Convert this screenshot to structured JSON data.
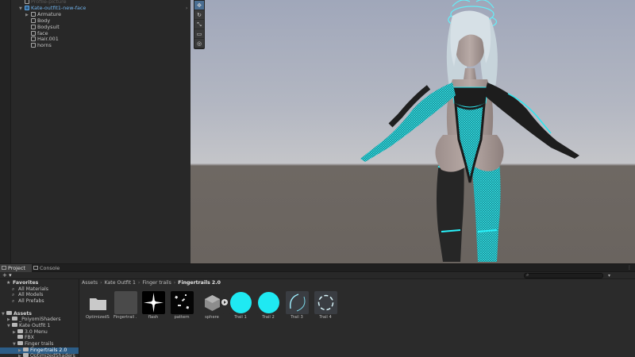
{
  "hierarchy": {
    "items": [
      {
        "label": "Profile-picture",
        "depth": 0,
        "faded": true
      },
      {
        "label": "Kate-outfit1-new-face",
        "depth": 0,
        "root": true,
        "expanded": true
      },
      {
        "label": "Armature",
        "depth": 1,
        "collapsed": true
      },
      {
        "label": "Body",
        "depth": 1
      },
      {
        "label": "Bodysuit",
        "depth": 1
      },
      {
        "label": "face",
        "depth": 1
      },
      {
        "label": "Hair.001",
        "depth": 1
      },
      {
        "label": "horns",
        "depth": 1
      }
    ]
  },
  "scene": {
    "tools": [
      "move-tool",
      "rotate-tool",
      "scale-tool",
      "rect-tool",
      "transform-tool"
    ]
  },
  "tabs": [
    {
      "label": "Project",
      "active": true
    },
    {
      "label": "Console",
      "active": false
    }
  ],
  "toolbar": {
    "add_label": "+ ▾"
  },
  "tree": {
    "items": [
      {
        "label": "Favorites",
        "depth": 0,
        "bold": true,
        "star": true
      },
      {
        "label": "All Materials",
        "depth": 1,
        "search": true
      },
      {
        "label": "All Models",
        "depth": 1,
        "search": true
      },
      {
        "label": "All Prefabs",
        "depth": 1,
        "search": true
      },
      {
        "label": "",
        "depth": 0,
        "spacer": true
      },
      {
        "label": "Assets",
        "depth": 0,
        "bold": true,
        "folder": true,
        "expanded": true
      },
      {
        "label": "_PoiyomiShaders",
        "depth": 1,
        "folder": true,
        "collapsed": true
      },
      {
        "label": "Kate Outfit 1",
        "depth": 1,
        "folder": true,
        "expanded": true
      },
      {
        "label": "3.0 Menu",
        "depth": 2,
        "folder": true,
        "collapsed": true
      },
      {
        "label": "FBX",
        "depth": 2,
        "folder": true
      },
      {
        "label": "Finger trails",
        "depth": 2,
        "folder": true,
        "expanded": true
      },
      {
        "label": "Fingertrails 2.0",
        "depth": 3,
        "folder": true,
        "selected": true,
        "collapsed": true
      },
      {
        "label": "OptimizedShaders",
        "depth": 3,
        "folder": true,
        "collapsed": true
      }
    ]
  },
  "breadcrumb": {
    "parts": [
      "Assets",
      "Kate Outfit 1",
      "Finger trails"
    ],
    "current": "Fingertrails 2.0",
    "separator": "›"
  },
  "assets": [
    {
      "label": "OptimizedS...",
      "kind": "folder"
    },
    {
      "label": "Fingertrail ...",
      "kind": "material-gray"
    },
    {
      "label": "flash",
      "kind": "flash"
    },
    {
      "label": "pattern",
      "kind": "pattern"
    },
    {
      "label": "sphere",
      "kind": "mesh"
    },
    {
      "label": "Trail 1",
      "kind": "cyan"
    },
    {
      "label": "Trail 2",
      "kind": "cyan"
    },
    {
      "label": "Trail 3",
      "kind": "arc"
    },
    {
      "label": "Trail 4",
      "kind": "ring"
    }
  ],
  "colors": {
    "selection": "#2c5d87",
    "accent_cyan": "#1fe9f2",
    "panel": "#282828"
  }
}
